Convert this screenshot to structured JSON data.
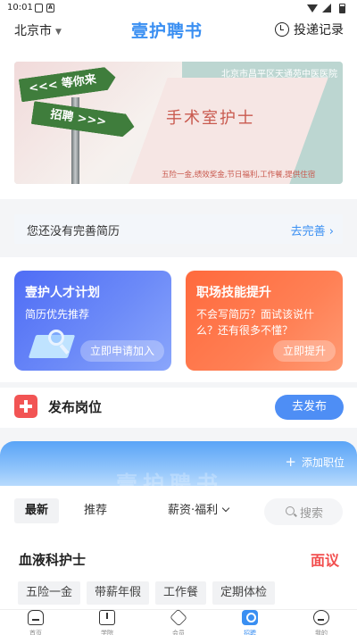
{
  "status_bar": {
    "time": "10:01",
    "icons": [
      "sim-icon",
      "notification-a-icon",
      "wifi-icon",
      "signal-icon",
      "battery-icon"
    ]
  },
  "header": {
    "city": "北京市",
    "logo": "壹护聘书",
    "delivery_record": "投递记录"
  },
  "banner": {
    "sign_top": "<<< 等你来",
    "sign_bottom": "招聘 >>>",
    "address": "北京市昌平区天通苑中医医院",
    "title": "手术室护士",
    "benefits": "五险一金,绩效奖金,节日福利,工作餐,提供住宿"
  },
  "resume_prompt": {
    "text": "您还没有完善简历",
    "action": "去完善 ›"
  },
  "promo_cards": [
    {
      "title": "壹护人才计划",
      "subtitle": "简历优先推荐",
      "button": "立即申请加入",
      "color": "#5a78f6"
    },
    {
      "title": "职场技能提升",
      "subtitle": "不会写简历？面试该说什么？还有很多不懂？",
      "button": "立即提升",
      "color": "#ff7048"
    }
  ],
  "publish": {
    "title": "发布岗位",
    "button": "去发布"
  },
  "post_card": {
    "watermark": "壹护聘书",
    "add": "添加职位"
  },
  "filters": {
    "tabs": [
      "最新",
      "推荐"
    ],
    "salary": "薪资·福利",
    "search_placeholder": "搜索"
  },
  "job": {
    "title": "血液科护士",
    "salary": "面议",
    "tags": [
      "五险一金",
      "带薪年假",
      "工作餐",
      "定期体检"
    ]
  },
  "tabbar": [
    {
      "label": "首页",
      "icon": "home-icon"
    },
    {
      "label": "学院",
      "icon": "book-icon"
    },
    {
      "label": "会员",
      "icon": "diamond-icon"
    },
    {
      "label": "招聘",
      "icon": "recruit-icon",
      "active": true
    },
    {
      "label": "我的",
      "icon": "profile-icon"
    }
  ],
  "colors": {
    "accent": "#3a8ff2",
    "danger": "#f24f4f",
    "publish_red": "#f25454"
  }
}
